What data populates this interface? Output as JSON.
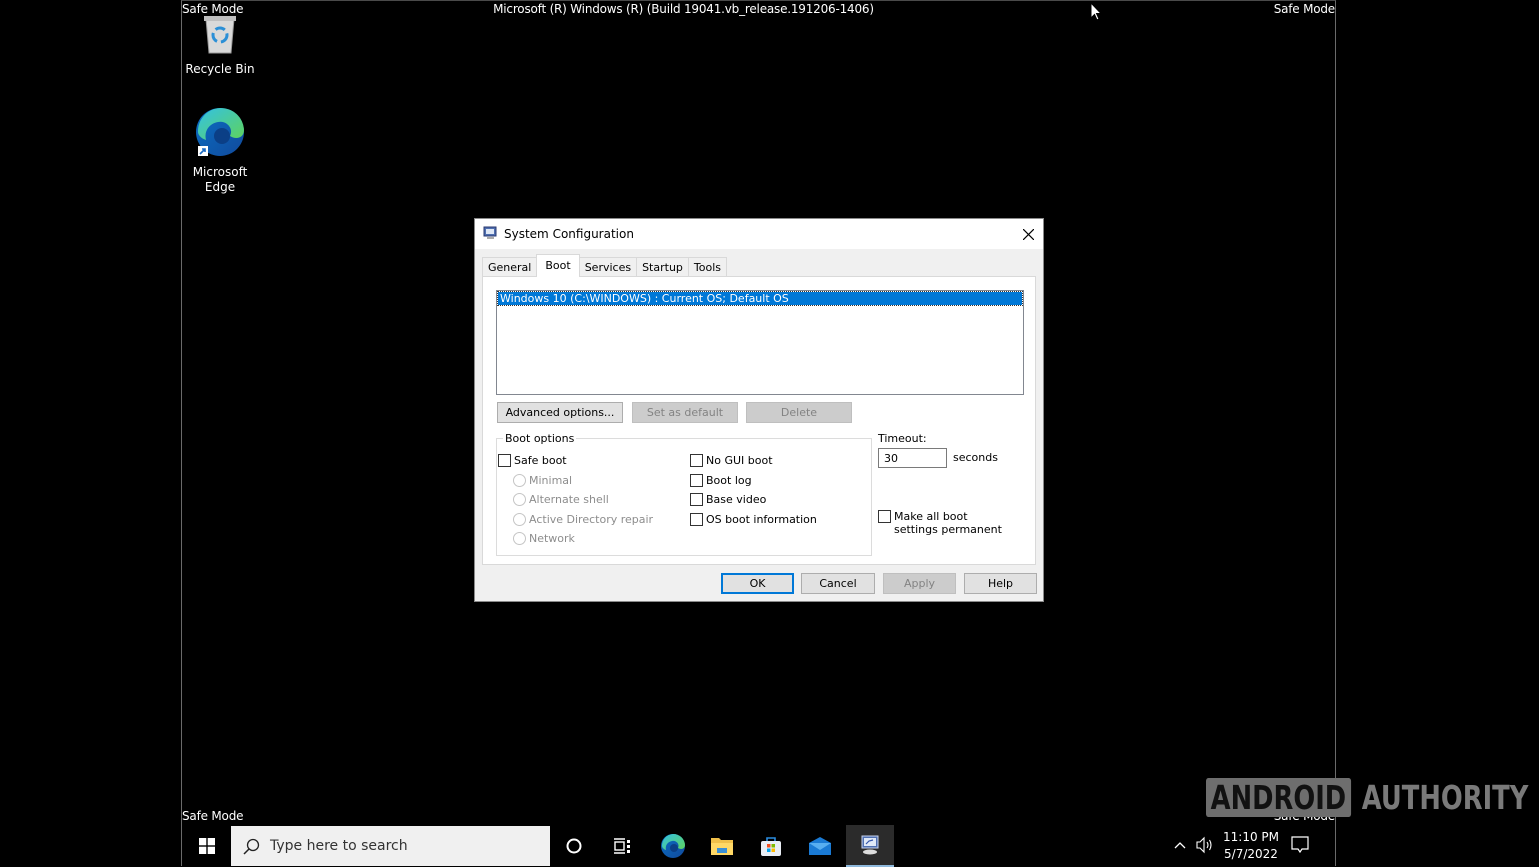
{
  "desktop": {
    "safe_mode_label": "Safe Mode",
    "build_string": "Microsoft (R) Windows (R) (Build 19041.vb_release.191206-1406)",
    "icons": [
      {
        "name": "recycle-bin",
        "label": "Recycle Bin",
        "icon": "recycle-bin-icon"
      },
      {
        "name": "microsoft-edge",
        "label": "Microsoft Edge",
        "icon": "edge-icon"
      }
    ]
  },
  "dialog": {
    "title": "System Configuration",
    "tabs": [
      {
        "label": "General",
        "active": false
      },
      {
        "label": "Boot",
        "active": true
      },
      {
        "label": "Services",
        "active": false
      },
      {
        "label": "Startup",
        "active": false
      },
      {
        "label": "Tools",
        "active": false
      }
    ],
    "os_list": [
      "Windows 10 (C:\\WINDOWS) : Current OS; Default OS"
    ],
    "buttons": {
      "advanced": "Advanced options...",
      "set_default": "Set as default",
      "delete": "Delete"
    },
    "boot_options": {
      "legend": "Boot options",
      "safe_boot": {
        "label": "Safe boot",
        "checked": false
      },
      "safe_boot_modes": [
        {
          "label": "Minimal",
          "selected": false,
          "enabled": false
        },
        {
          "label": "Alternate shell",
          "selected": false,
          "enabled": false
        },
        {
          "label": "Active Directory repair",
          "selected": false,
          "enabled": false
        },
        {
          "label": "Network",
          "selected": false,
          "enabled": false
        }
      ],
      "flags": [
        {
          "label": "No GUI boot",
          "checked": false
        },
        {
          "label": "Boot log",
          "checked": false
        },
        {
          "label": "Base video",
          "checked": false
        },
        {
          "label": "OS boot information",
          "checked": false
        }
      ]
    },
    "timeout": {
      "label": "Timeout:",
      "value": "30",
      "unit": "seconds"
    },
    "permanent": {
      "label": "Make all boot settings permanent",
      "checked": false
    },
    "footer": {
      "ok": "OK",
      "cancel": "Cancel",
      "apply": "Apply",
      "help": "Help"
    }
  },
  "taskbar": {
    "search_placeholder": "Type here to search",
    "pinned": [
      "cortana",
      "task-view",
      "microsoft-edge",
      "file-explorer",
      "microsoft-store",
      "mail",
      "system-configuration"
    ],
    "clock": {
      "time": "11:10 PM",
      "date": "5/7/2022"
    }
  },
  "watermark": {
    "part1": "ANDROID",
    "part2": "AUTHORITY"
  }
}
